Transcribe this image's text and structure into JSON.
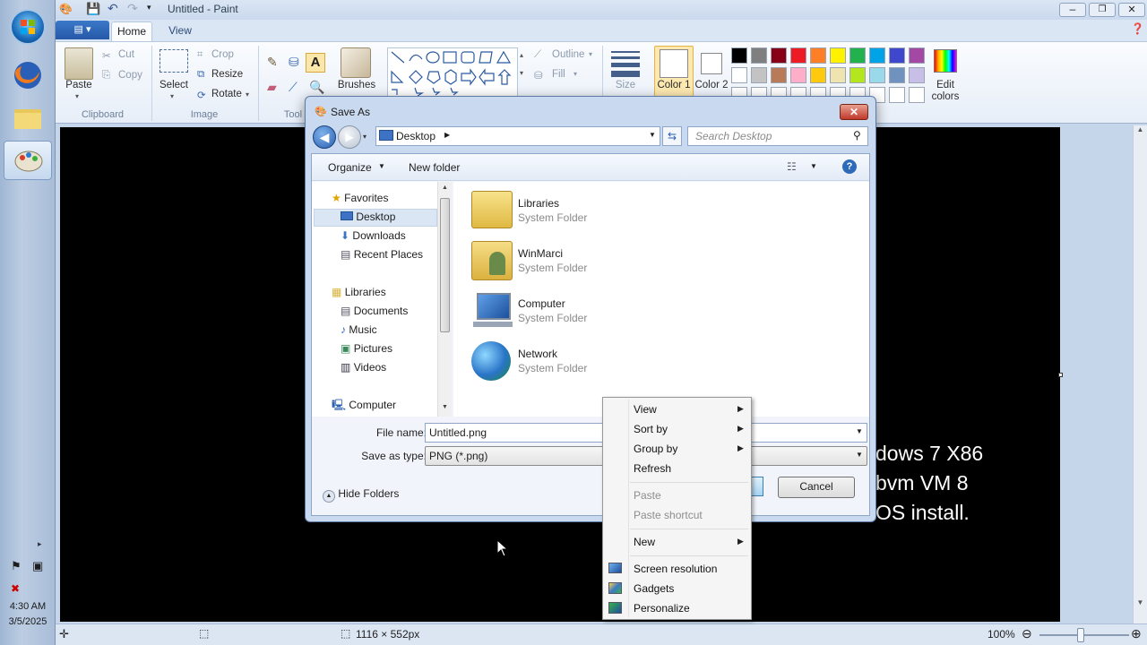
{
  "app": {
    "title": "Untitled - Paint"
  },
  "ribbon": {
    "tabs": [
      "Home",
      "View"
    ],
    "clipboard": {
      "paste": "Paste",
      "cut": "Cut",
      "copy": "Copy",
      "label": "Clipboard"
    },
    "image": {
      "select": "Select",
      "crop": "Crop",
      "resize": "Resize",
      "rotate": "Rotate",
      "label": "Image"
    },
    "tools": {
      "label": "Tool"
    },
    "brushes": "Brushes",
    "shapes": {
      "outline": "Outline",
      "fill": "Fill"
    },
    "size": "Size",
    "color1": "Color 1",
    "color2": "Color 2",
    "edit_colors": "Edit colors",
    "palette_row1": [
      "#000000",
      "#7f7f7f",
      "#880015",
      "#ed1c24",
      "#ff7f27",
      "#fff200",
      "#22b14c",
      "#00a2e8",
      "#3f48cc",
      "#a349a4"
    ],
    "palette_row2": [
      "#ffffff",
      "#c3c3c3",
      "#b97a57",
      "#ffaec9",
      "#ffc90e",
      "#efe4b0",
      "#b5e61d",
      "#99d9ea",
      "#7092be",
      "#c8bfe7"
    ],
    "palette_row3": [
      "#ffffff",
      "#ffffff",
      "#ffffff",
      "#ffffff",
      "#ffffff",
      "#ffffff",
      "#ffffff",
      "#ffffff",
      "#ffffff",
      "#ffffff"
    ]
  },
  "canvas_text": [
    "dows 7 X86",
    "bvm VM 8",
    "OS install."
  ],
  "status": {
    "size": "1116 × 552px",
    "zoom": "100%"
  },
  "tray": {
    "time": "4:30 AM",
    "date": "3/5/2025"
  },
  "dialog": {
    "title": "Save As",
    "address": "Desktop",
    "search_placeholder": "Search Desktop",
    "organize": "Organize",
    "new_folder": "New folder",
    "nav": {
      "favorites": "Favorites",
      "desktop": "Desktop",
      "downloads": "Downloads",
      "recent": "Recent Places",
      "libraries": "Libraries",
      "documents": "Documents",
      "music": "Music",
      "pictures": "Pictures",
      "videos": "Videos",
      "computer": "Computer"
    },
    "items": [
      {
        "name": "Libraries",
        "type": "System Folder"
      },
      {
        "name": "WinMarci",
        "type": "System Folder"
      },
      {
        "name": "Computer",
        "type": "System Folder"
      },
      {
        "name": "Network",
        "type": "System Folder"
      }
    ],
    "file_name_label": "File name:",
    "file_name_value": "Untitled.png",
    "save_type_label": "Save as type:",
    "save_type_value": "PNG (*.png)",
    "hide_folders": "Hide Folders",
    "cancel": "Cancel"
  },
  "context_menu": {
    "view": "View",
    "sort_by": "Sort by",
    "group_by": "Group by",
    "refresh": "Refresh",
    "paste": "Paste",
    "paste_shortcut": "Paste shortcut",
    "new": "New",
    "screen_resolution": "Screen resolution",
    "gadgets": "Gadgets",
    "personalize": "Personalize"
  }
}
